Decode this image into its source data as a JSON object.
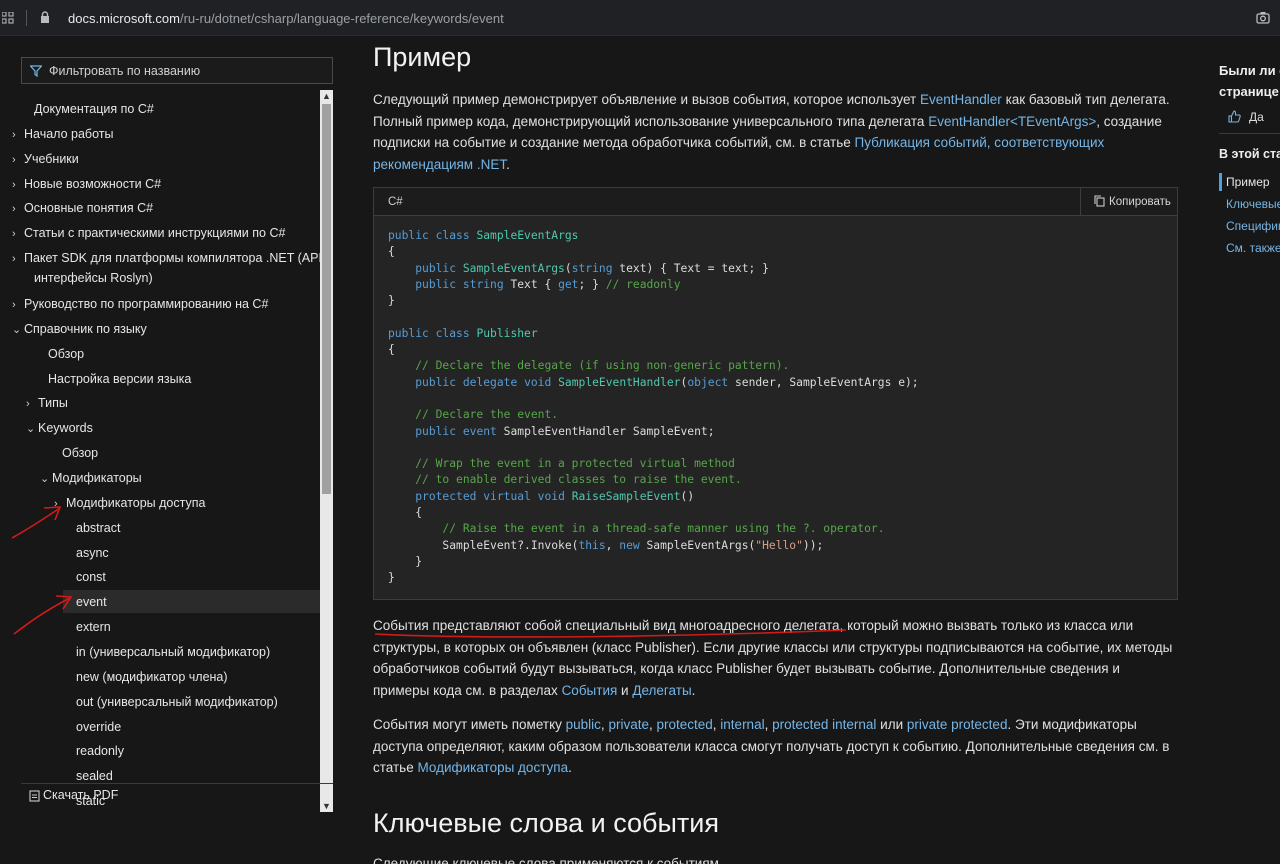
{
  "browser": {
    "url_host": "docs.microsoft.com",
    "url_path": "/ru-ru/dotnet/csharp/language-reference/keywords/event"
  },
  "sidebar": {
    "filter_placeholder": "Фильтровать по названию",
    "items": [
      {
        "label": "Документация по C#",
        "chev": ""
      },
      {
        "label": "Начало работы",
        "chev": "›"
      },
      {
        "label": "Учебники",
        "chev": "›"
      },
      {
        "label": "Новые возможности C#",
        "chev": "›"
      },
      {
        "label": "Основные понятия C#",
        "chev": "›"
      },
      {
        "label": "Статьи с практическими инструкциями по C#",
        "chev": "›"
      },
      {
        "label": "Пакет SDK для платформы компилятора .NET (API-",
        "chev": "›"
      },
      {
        "label": "интерфейсы Roslyn)",
        "chev": ""
      },
      {
        "label": "Руководство по программированию на C#",
        "chev": "›"
      },
      {
        "label": "Справочник по языку",
        "chev": "⌄"
      },
      {
        "label": "Обзор",
        "chev": ""
      },
      {
        "label": "Настройка версии языка",
        "chev": ""
      },
      {
        "label": "Типы",
        "chev": "›"
      },
      {
        "label": "Keywords",
        "chev": "⌄"
      },
      {
        "label": "Обзор",
        "chev": ""
      },
      {
        "label": "Модификаторы",
        "chev": "⌄"
      },
      {
        "label": "Модификаторы доступа",
        "chev": "›"
      },
      {
        "label": "abstract",
        "chev": ""
      },
      {
        "label": "async",
        "chev": ""
      },
      {
        "label": "const",
        "chev": ""
      },
      {
        "label": "event",
        "chev": ""
      },
      {
        "label": "extern",
        "chev": ""
      },
      {
        "label": "in (универсальный модификатор)",
        "chev": ""
      },
      {
        "label": "new (модификатор члена)",
        "chev": ""
      },
      {
        "label": "out (универсальный модификатор)",
        "chev": ""
      },
      {
        "label": "override",
        "chev": ""
      },
      {
        "label": "readonly",
        "chev": ""
      },
      {
        "label": "sealed",
        "chev": ""
      },
      {
        "label": "static",
        "chev": ""
      }
    ],
    "active_item": "event",
    "download_pdf": "Скачать PDF"
  },
  "main": {
    "title": "Пример",
    "intro": {
      "t1": "Следующий пример демонстрирует объявление и вызов события, которое использует ",
      "l1": "EventHandler",
      "t2": " как базовый тип делегата. Полный пример кода, демонстрирующий использование универсального типа делегата ",
      "l2": "EventHandler<TEventArgs>",
      "t3": ", создание подписки на событие и создание метода обработчика событий, см. в статье ",
      "l3": "Публикация событий, соответствующих рекомендациям .NET",
      "t4": "."
    },
    "code": {
      "lang": "C#",
      "copy_label": "Копировать"
    },
    "para2": {
      "t1": "События представляют собой специальный вид многоадресного делегата",
      "t2": ", который можно вызвать только из класса или структуры, в которых он объявлен (класс Publisher). Если другие классы или структуры подписываются на событие, их методы обработчиков событий будут вызываться, когда класс Publisher будет вызывать событие. Дополнительные сведения и примеры кода см. в разделах ",
      "l1": "События",
      "t3": " и ",
      "l2": "Делегаты",
      "t4": "."
    },
    "para3": {
      "t1": "События могут иметь пометку ",
      "l1": "public",
      "s1": ", ",
      "l2": "private",
      "s2": ", ",
      "l3": "protected",
      "s3": ", ",
      "l4": "internal",
      "s4": ", ",
      "l5": "protected internal",
      "s5": " или ",
      "l6": "private protected",
      "t2": ". Эти модификаторы доступа определяют, каким образом пользователи класса смогут получать доступ к событию. Дополнительные сведения см. в статье ",
      "l7": "Модификаторы доступа",
      "t3": "."
    },
    "section2_title": "Ключевые слова и события",
    "cut_text": "Следующие ключевые слова применяются к событиям."
  },
  "rail": {
    "feedback_line1": "Были ли с",
    "feedback_line2": "странице",
    "yes_label": "Да",
    "toc_heading": "В этой ста",
    "toc_items": [
      "Пример",
      "Ключевые",
      "Специфик",
      "См. также"
    ]
  },
  "colors": {
    "background": "#171717",
    "link": "#75b6e7",
    "keyword": "#569cd6",
    "type": "#4ec9b0",
    "comment": "#57a64a",
    "annotation": "#d11a1a"
  }
}
